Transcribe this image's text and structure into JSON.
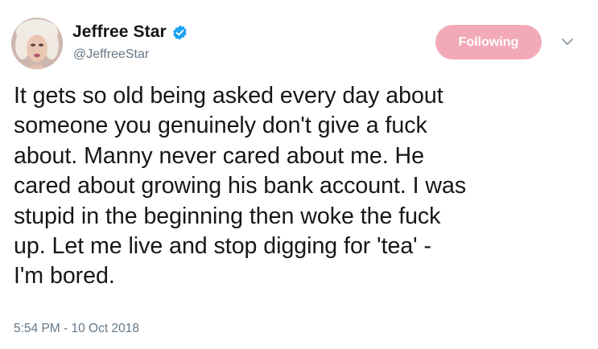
{
  "user": {
    "display_name": "Jeffree Star",
    "handle": "@JeffreeStar",
    "verified": true
  },
  "follow_button": {
    "label": "Following",
    "color": "#f3aab8"
  },
  "tweet": {
    "lines": [
      "It gets so old being asked every day about",
      "someone you genuinely don't give a fuck",
      "about. Manny never cared about me. He",
      "cared about growing his bank account. I was",
      "stupid in the beginning then woke the fuck",
      "up. Let me live and stop digging for 'tea' -",
      "I'm bored."
    ],
    "timestamp": "5:54 PM - 10 Oct 2018"
  },
  "icons": {
    "verified": "verified-badge-icon",
    "caret": "chevron-down-icon"
  },
  "colors": {
    "text": "#14171a",
    "secondary": "#657786",
    "verified_blue": "#1da1f2"
  }
}
